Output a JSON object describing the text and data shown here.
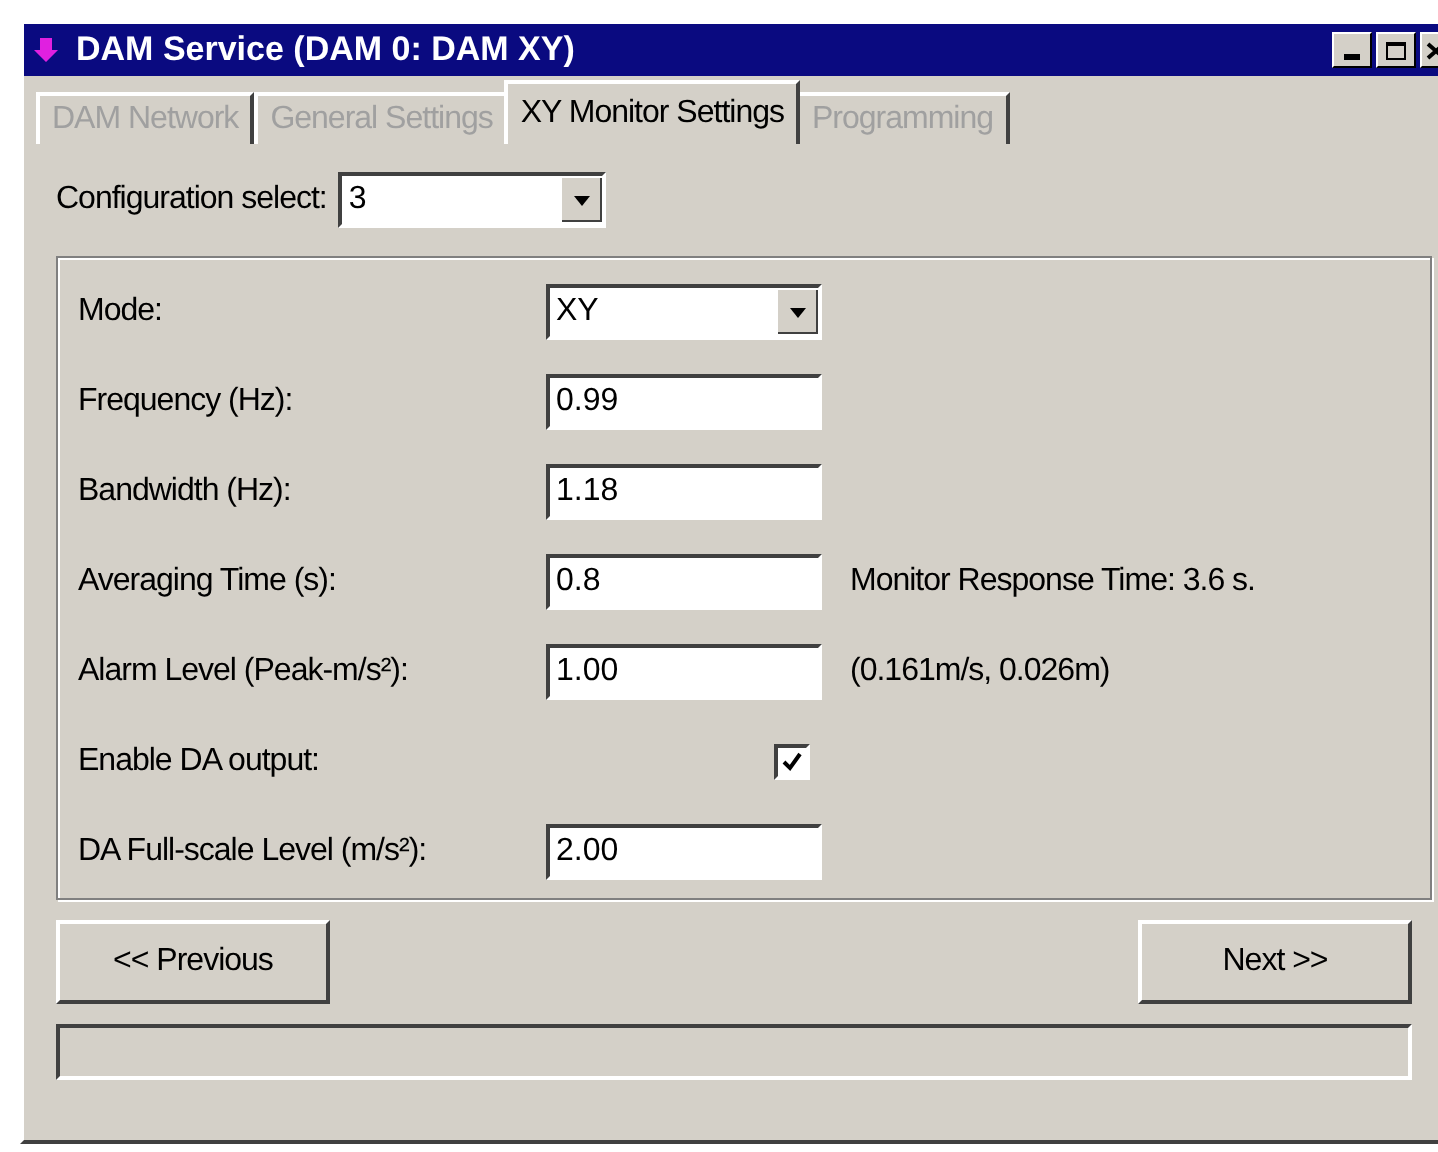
{
  "window": {
    "title": "DAM Service (DAM 0: DAM XY)"
  },
  "tabs": [
    {
      "label": "DAM Network",
      "selected": false,
      "disabled": true
    },
    {
      "label": "General Settings",
      "selected": false,
      "disabled": true
    },
    {
      "label": "XY Monitor Settings",
      "selected": true,
      "disabled": false
    },
    {
      "label": "Programming",
      "selected": false,
      "disabled": true
    }
  ],
  "configuration": {
    "label": "Configuration select:",
    "value": "3"
  },
  "settings": [
    {
      "kind": "dropdown",
      "label": "Mode:",
      "value": "XY"
    },
    {
      "kind": "text",
      "label": "Frequency (Hz):",
      "value": "0.99"
    },
    {
      "kind": "text",
      "label": "Bandwidth (Hz):",
      "value": "1.18"
    },
    {
      "kind": "text",
      "label": "Averaging Time (s):",
      "value": "0.8",
      "note": "Monitor Response Time: 3.6 s."
    },
    {
      "kind": "text",
      "label": "Alarm Level (Peak-m/s²):",
      "value": "1.00",
      "note": "(0.161m/s, 0.026m)"
    },
    {
      "kind": "checkbox",
      "label": "Enable DA output:",
      "checked": true
    },
    {
      "kind": "text",
      "label": "DA Full-scale Level (m/s²):",
      "value": "2.00"
    }
  ],
  "buttons": [
    {
      "label": "<< Previous"
    },
    {
      "label": "Next >>"
    }
  ]
}
